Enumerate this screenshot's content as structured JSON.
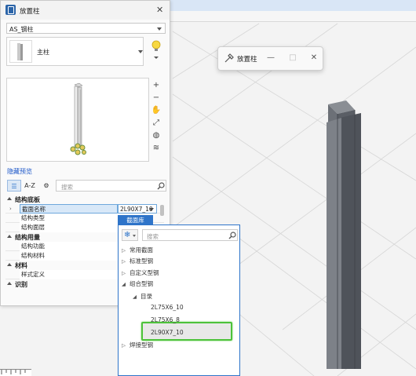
{
  "main_panel": {
    "title": "放置柱",
    "family_select": "AS_钢柱",
    "type_name": "主柱",
    "hide_preview_link": "隐藏预览",
    "toolbar": {
      "az_label": "A-Z",
      "search_placeholder": "搜索"
    },
    "properties": {
      "group_profile": "结构底板",
      "profile_name_label": "截面名称",
      "profile_name_value": "2L90X7_10",
      "structure_type_label": "结构类型",
      "structure_plane_label": "结构面层",
      "group_usage": "结构用量",
      "structure_function_label": "结构功能",
      "structure_material_label": "结构材料",
      "group_material": "材料",
      "style_definition_label": "样式定义",
      "group_identity": "识别"
    }
  },
  "mini_dialog": {
    "title": "放置柱"
  },
  "section_library": {
    "tab_label": "截面库",
    "search_placeholder": "搜索",
    "tree": {
      "common": "常用截面",
      "standard": "标准型钢",
      "custom": "自定义型钢",
      "combined": "组合型钢",
      "catalog": "目录",
      "item1": "2L75X6_10",
      "item2": "2L75X6_8",
      "item3": "2L90X7_10",
      "welded": "焊接型钢"
    }
  },
  "colors": {
    "accent": "#2e74c9",
    "highlight": "#4cc23a",
    "link": "#1a55c8"
  }
}
